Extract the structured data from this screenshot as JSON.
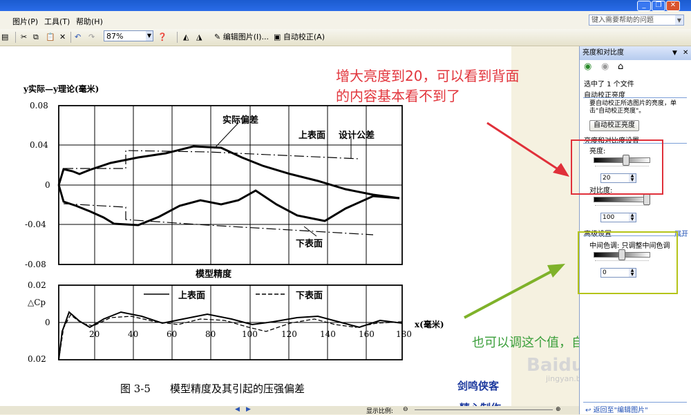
{
  "menu": {
    "items": [
      "图片(P)",
      "工具(T)",
      "帮助(H)"
    ],
    "help_placeholder": "键入需要帮助的问题"
  },
  "toolbar": {
    "zoom": "87%",
    "edit_picture": "编辑图片(I)...",
    "auto_correct": "自动校正(A)"
  },
  "figure": {
    "ytop_label": "y实际—y理论(毫米)",
    "y_ticks": [
      "0.08",
      "0.04",
      "0",
      "-0.04",
      "-0.08"
    ],
    "actual_dev": "实际偏差",
    "upper_surface": "上表面",
    "design_tol": "设计公差",
    "lower_surface": "下表面",
    "model_precision": "模型精度",
    "lower_y_ticks": [
      "0.02",
      "0",
      "0.02"
    ],
    "delta_cp": "△Cp",
    "legend_upper": "上表面",
    "legend_lower": "下表面",
    "x_ticks": [
      "20",
      "40",
      "60",
      "80",
      "100",
      "120",
      "140",
      "160",
      "180"
    ],
    "x_unit": "x(毫米)",
    "caption_num": "图 3-5",
    "caption": "模型精度及其引起的压强偏差"
  },
  "pane": {
    "title": "亮度和对比度",
    "selected": "选中了 1 个文件",
    "auto_section": "自动校正亮度",
    "auto_desc": "要自动校正所选图片的亮度，单击\"自动校正亮度\"。",
    "auto_button": "自动校正亮度",
    "settings_section": "亮度和对比度设置",
    "brightness_label": "亮度:",
    "brightness_value": 20,
    "brightness_value_text": "20",
    "contrast_label": "对比度:",
    "contrast_value": 100,
    "contrast_value_text": "100",
    "advanced_section": "高级设置",
    "expand_link": "展开",
    "midtone_label": "中间色调: 只调整中间色调",
    "midtone_value": 0,
    "midtone_value_text": "0",
    "back_link": "返回至\"编辑图片\""
  },
  "annotations": {
    "red_note_line1": "增大亮度到20，可以看到背面",
    "red_note_line2": "的内容基本看不到了",
    "green_note": "也可以调这个值，自己尝试下"
  },
  "watermark": {
    "author_line1": "剑鸣侠客",
    "author_line2": "精心制作",
    "baidu": "Baidu经验",
    "baidu_url": "jingyan.baidu.com"
  },
  "status": {
    "display_ratio": "显示比例:"
  }
}
